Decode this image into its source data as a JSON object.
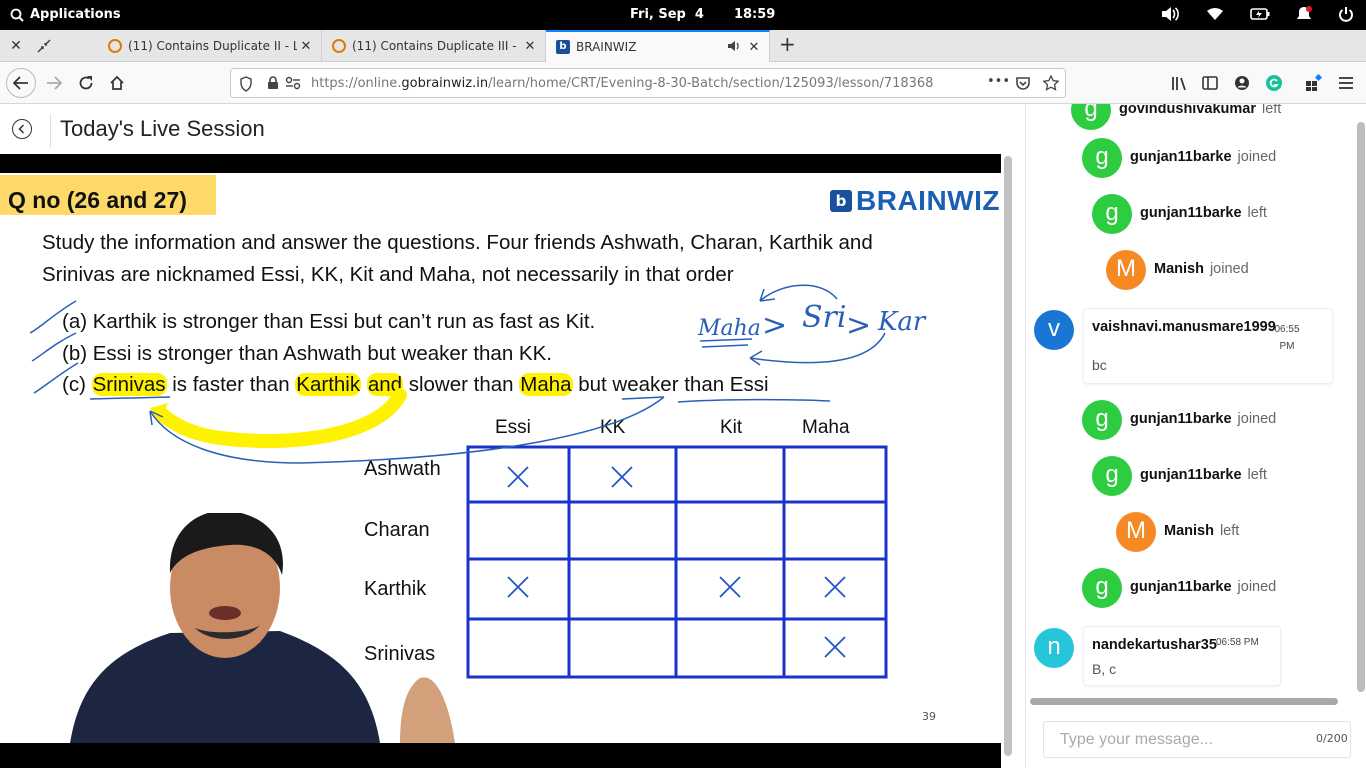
{
  "system_bar": {
    "apps_label": "Applications",
    "date": "Fri, Sep  4",
    "time": "18:59"
  },
  "tabs": [
    {
      "title": "(11) Contains Duplicate II - Le",
      "icon": "leetcode-icon"
    },
    {
      "title": "(11) Contains Duplicate III - Le",
      "icon": "leetcode-icon"
    },
    {
      "title": "BRAINWIZ",
      "icon": "brainwiz-icon",
      "active": true
    }
  ],
  "navbar": {
    "url_prefix": "https://online.",
    "url_domain": "gobrainwiz.in",
    "url_path": "/learn/home/CRT/Evening-8-30-Batch/section/125093/lesson/718368",
    "overflow": "•••"
  },
  "page": {
    "title": "Today's Live Session"
  },
  "slide": {
    "question_no": "Q no (26 and 27)",
    "logo_text": "BRAINWIZ",
    "logo_mark": "b",
    "intro_line1": "Study the information and answer the questions. Four friends Ashwath, Charan, Karthik and",
    "intro_line2": "Srinivas are nicknamed Essi, KK, Kit and Maha, not necessarily in that order",
    "clue_a": "(a) Karthik is stronger than Essi but can’t run as fast as Kit.",
    "clue_b": "(b) Essi is stronger than Ashwath but weaker than KK.",
    "clue_c_parts": [
      "(c) ",
      "Srinivas",
      " is faster than ",
      "Karthik",
      " ",
      "and",
      " slower than ",
      "Maha",
      " but weaker than Essi"
    ],
    "columns": [
      "Essi",
      "KK",
      "Kit",
      "Maha"
    ],
    "rows": [
      "Ashwath",
      "Charan",
      "Karthik",
      "Srinivas"
    ],
    "grid_marks": [
      [
        1,
        1,
        0,
        0
      ],
      [
        0,
        0,
        0,
        0
      ],
      [
        1,
        0,
        1,
        1
      ],
      [
        0,
        0,
        0,
        1
      ]
    ],
    "handwriting": {
      "maha": "Maha",
      "sri": "Sri",
      "kar": "Kar",
      "gt": ">"
    },
    "page_number": "39"
  },
  "chat": {
    "events": [
      {
        "type": "event",
        "initial": "g",
        "name": "govindushivakumar",
        "action": "left",
        "color": "#2ecc40"
      },
      {
        "type": "event",
        "initial": "g",
        "name": "gunjan11barke",
        "action": "joined",
        "color": "#2ecc40"
      },
      {
        "type": "event",
        "initial": "g",
        "name": "gunjan11barke",
        "action": "left",
        "color": "#2ecc40"
      },
      {
        "type": "event",
        "initial": "M",
        "name": "Manish",
        "action": "joined",
        "color": "#f58a24"
      },
      {
        "type": "message",
        "initial": "v",
        "name": "vaishnavi.manusmare1999",
        "time": "06:55 PM",
        "text": "bc",
        "color": "#1976d2"
      },
      {
        "type": "event",
        "initial": "g",
        "name": "gunjan11barke",
        "action": "joined",
        "color": "#2ecc40"
      },
      {
        "type": "event",
        "initial": "g",
        "name": "gunjan11barke",
        "action": "left",
        "color": "#2ecc40"
      },
      {
        "type": "event",
        "initial": "M",
        "name": "Manish",
        "action": "left",
        "color": "#f58a24"
      },
      {
        "type": "event",
        "initial": "g",
        "name": "gunjan11barke",
        "action": "joined",
        "color": "#2ecc40"
      },
      {
        "type": "message",
        "initial": "n",
        "name": "nandekartushar35",
        "time": "06:58 PM",
        "text": "B, c",
        "color": "#26c6da"
      }
    ],
    "input_placeholder": "Type your message...",
    "char_count": "0/200"
  }
}
